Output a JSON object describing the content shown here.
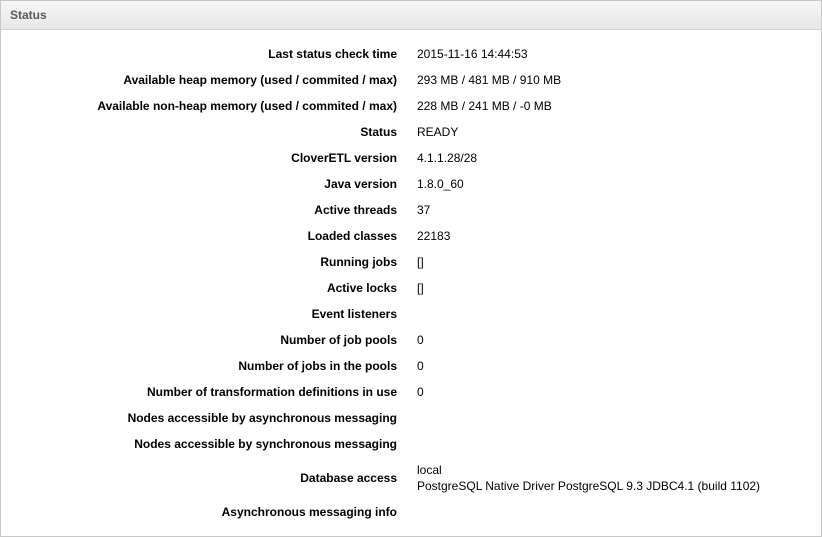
{
  "panel": {
    "title": "Status"
  },
  "rows": [
    {
      "label": "Last status check time",
      "value": "2015-11-16 14:44:53"
    },
    {
      "label": "Available heap memory (used / commited / max)",
      "value": "293 MB / 481 MB / 910 MB"
    },
    {
      "label": "Available non-heap memory (used / commited / max)",
      "value": "228 MB / 241 MB / -0 MB"
    },
    {
      "label": "Status",
      "value": "READY"
    },
    {
      "label": "CloverETL version",
      "value": "4.1.1.28/28"
    },
    {
      "label": "Java version",
      "value": "1.8.0_60"
    },
    {
      "label": "Active threads",
      "value": "37"
    },
    {
      "label": "Loaded classes",
      "value": "22183"
    },
    {
      "label": "Running jobs",
      "value": "[]"
    },
    {
      "label": "Active locks",
      "value": "[]"
    },
    {
      "label": "Event listeners",
      "value": ""
    },
    {
      "label": "Number of job pools",
      "value": "0"
    },
    {
      "label": "Number of jobs in the pools",
      "value": "0"
    },
    {
      "label": "Number of transformation definitions in use",
      "value": "0"
    },
    {
      "label": "Nodes accessible by asynchronous messaging",
      "value": ""
    },
    {
      "label": "Nodes accessible by synchronous messaging",
      "value": ""
    },
    {
      "label": "Database access",
      "value_line1": "local",
      "value_line2": "PostgreSQL Native Driver PostgreSQL 9.3 JDBC4.1 (build 1102)"
    },
    {
      "label": "Asynchronous messaging info",
      "value": ""
    }
  ]
}
